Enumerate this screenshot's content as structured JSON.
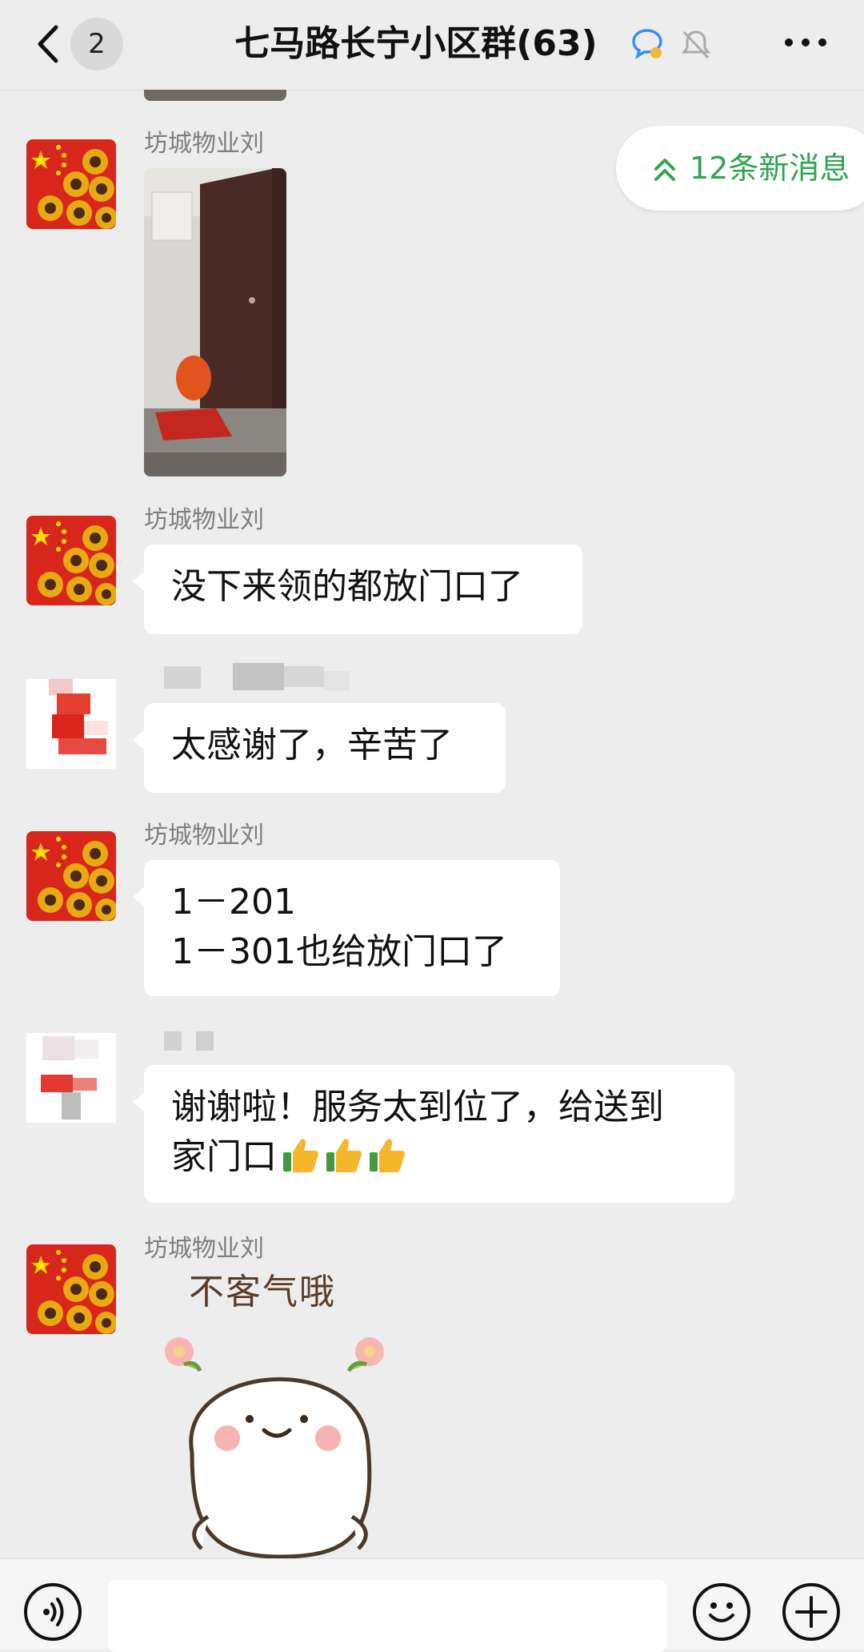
{
  "header": {
    "back_label": "‹",
    "unread_count": "2",
    "title": "七马路长宁小区群(63)",
    "more_label": "•••"
  },
  "new_messages": {
    "label": "12条新消息",
    "color": "#2fa44f"
  },
  "messages": [
    {
      "sender": "坊城物业刘",
      "type": "image"
    },
    {
      "sender": "坊城物业刘",
      "text": "没下来领的都放门口了"
    },
    {
      "sender": "",
      "text": "太感谢了，辛苦了"
    },
    {
      "sender": "坊城物业刘",
      "lines": [
        "1－201",
        "1－301也给放门口了"
      ]
    },
    {
      "sender": "",
      "text_line1": "谢谢啦！服务太到位了，给送到",
      "text_line2": "家门口",
      "emoji": [
        "thumbs-up",
        "thumbs-up",
        "thumbs-up"
      ]
    },
    {
      "sender": "坊城物业刘",
      "type": "sticker",
      "sticker_text": "不客气哦"
    }
  ],
  "input_bar": {
    "voice_icon": "voice-icon",
    "emoji_icon": "smiley-icon",
    "plus_icon": "plus-icon"
  }
}
